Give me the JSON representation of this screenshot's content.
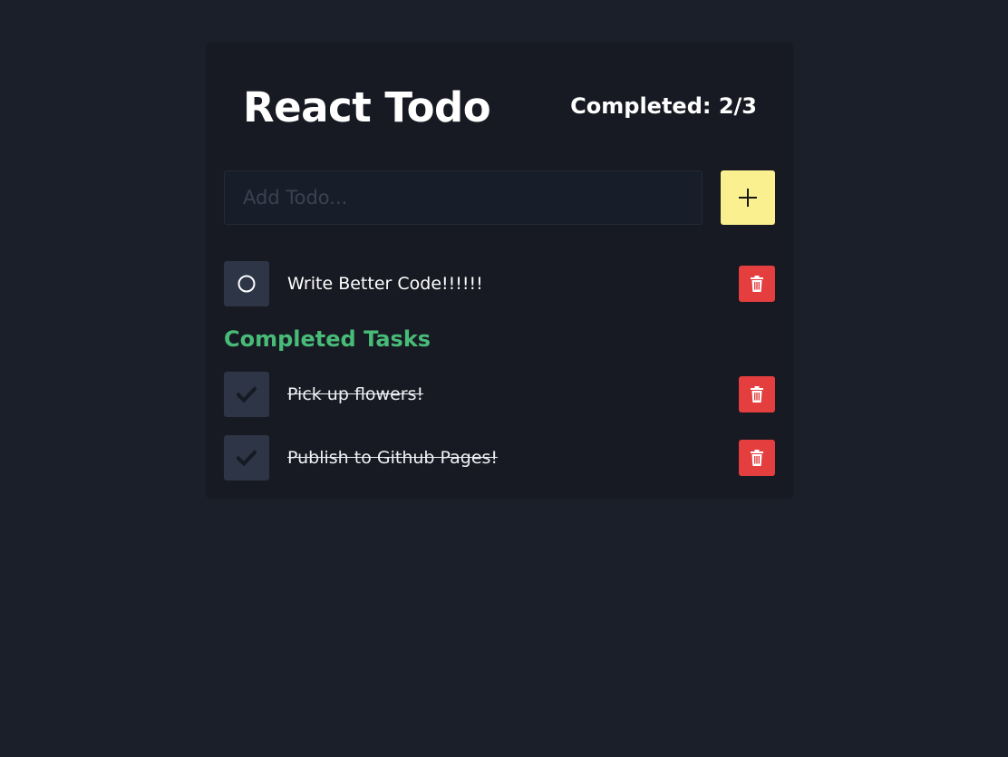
{
  "header": {
    "title": "React Todo",
    "completed_label": "Completed: 2/3"
  },
  "add_form": {
    "placeholder": "Add Todo...",
    "value": "",
    "add_icon": "plus-icon"
  },
  "todos": [
    {
      "text": "Write Better Code!!!!!!",
      "completed": false,
      "status_icon": "circle-icon",
      "delete_icon": "trash-icon"
    }
  ],
  "completed_section": {
    "heading": "Completed Tasks",
    "items": [
      {
        "text": "Pick up flowers!",
        "completed": true,
        "status_icon": "check-icon",
        "delete_icon": "trash-icon"
      },
      {
        "text": "Publish to Github Pages!",
        "completed": true,
        "status_icon": "check-icon",
        "delete_icon": "trash-icon"
      }
    ]
  },
  "colors": {
    "page_background": "#1a1f2a",
    "card_background": "#171a22",
    "accent_yellow": "#fbf08f",
    "delete_red": "#e53e3e",
    "completed_green": "#48bb78",
    "checkbox_background": "#2d3546"
  }
}
